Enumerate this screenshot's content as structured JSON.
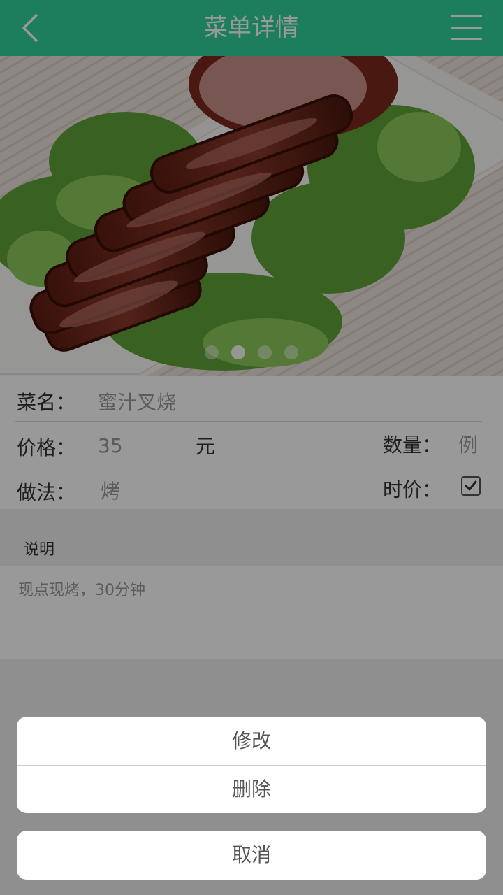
{
  "header": {
    "title": "菜单详情",
    "back_icon": "chevron-left-icon",
    "menu_icon": "hamburger-menu-icon",
    "bg_color": "#2fd39b"
  },
  "carousel": {
    "image": "honey-glazed-char-siu-photo",
    "slide_count": 4,
    "active_index": 1
  },
  "dish": {
    "name_label": "菜名：",
    "name_value": "蜜汁叉烧",
    "price_label": "价格：",
    "price_value": "35",
    "price_unit": "元",
    "qty_label": "数量：",
    "qty_value": "例",
    "method_label": "做法：",
    "method_value": "烤",
    "seasonal_label": "时价：",
    "seasonal_checked": true
  },
  "description": {
    "title": "说明",
    "text": "现点现烤，30分钟"
  },
  "action_sheet": {
    "edit_label": "修改",
    "delete_label": "删除",
    "cancel_label": "取消"
  }
}
